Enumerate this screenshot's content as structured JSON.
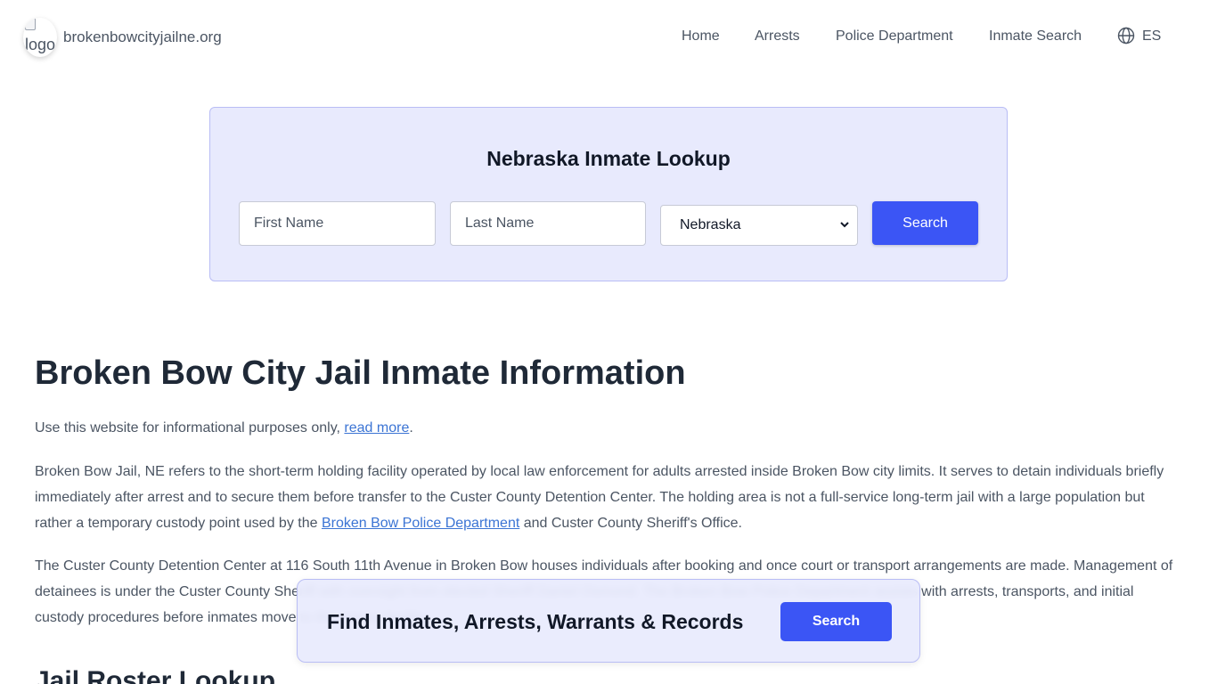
{
  "header": {
    "logo_alt": "logo",
    "site_name": "brokenbowcityjailne.org",
    "nav": [
      "Home",
      "Arrests",
      "Police Department",
      "Inmate Search"
    ],
    "language_icon": "globe-icon",
    "language_label": "ES"
  },
  "search": {
    "title": "Nebraska Inmate Lookup",
    "first_name_placeholder": "First Name",
    "last_name_placeholder": "Last Name",
    "state_selected": "Nebraska",
    "button_label": "Search"
  },
  "article": {
    "title": "Broken Bow City Jail Inmate Information",
    "intro_text": "Use this website for informational purposes only, ",
    "intro_link": "read more",
    "intro_end": ".",
    "p1_text_a": "Broken Bow Jail, NE refers to the short-term holding facility operated by local law enforcement for adults arrested inside Broken Bow city limits. It serves to detain individuals briefly immediately after arrest and to secure them before transfer to the Custer County Detention Center. The holding area is not a full-service long-term jail with a large population but rather a temporary custody point used by the ",
    "p1_link": "Broken Bow Police Department",
    "p1_text_b": " and Custer County Sheriff's Office.",
    "p2_text": "The Custer County Detention Center at 116 South 11th Avenue in Broken Bow houses individuals after booking and once court or transport arrangements are made. Management of detainees is under the Custer County Sheriff with oversight from elected Sheriff Daniel Osmond. The Broken Bow Police Department assists with arrests, transports, and initial custody procedures before inmates move to the county facility.",
    "section_title": "Jail Roster Lookup"
  },
  "float_bar": {
    "text": "Find Inmates, Arrests, Warrants & Records",
    "button_label": "Search"
  },
  "colors": {
    "accent": "#3b55f5",
    "card_bg": "#e8eafd",
    "link": "#3b74d4"
  }
}
